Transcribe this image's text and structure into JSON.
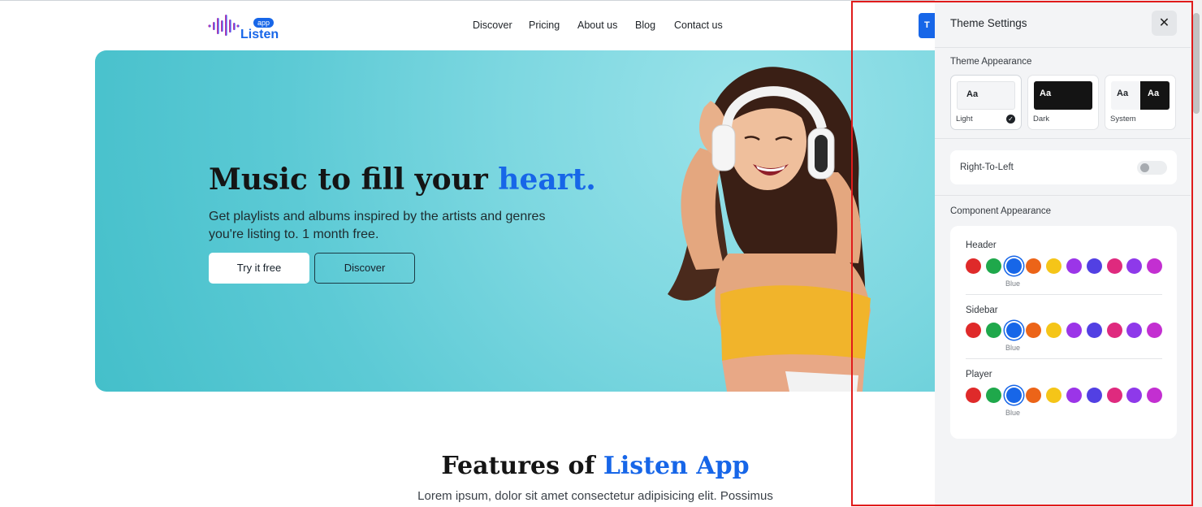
{
  "logo": {
    "badge": "app",
    "word": "Listen"
  },
  "nav": {
    "items": [
      "Discover",
      "Pricing",
      "About us",
      "Blog",
      "Contact us"
    ]
  },
  "cta_peek": "T",
  "hero": {
    "title_main": "Music to fill your ",
    "title_accent": "heart.",
    "subtitle": "Get playlists and albums inspired by the artists and genres you're listing to. 1 month free.",
    "try_button": "Try it free",
    "discover_button": "Discover"
  },
  "features": {
    "title_main": "Features of ",
    "title_accent": "Listen App",
    "subtitle": "Lorem ipsum, dolor sit amet consectetur adipisicing elit. Possimus"
  },
  "settings": {
    "title": "Theme Settings",
    "close_glyph": "✕",
    "appearance_label": "Theme Appearance",
    "themes": [
      {
        "preview": "Aa",
        "label": "Light",
        "selected": true
      },
      {
        "preview": "Aa",
        "label": "Dark",
        "selected": false
      },
      {
        "preview_light": "Aa",
        "preview_dark": "Aa",
        "label": "System",
        "selected": false
      }
    ],
    "rtl_label": "Right-To-Left",
    "rtl_enabled": false,
    "component_label": "Component Appearance",
    "groups": [
      {
        "label": "Header",
        "selected_caption": "Blue"
      },
      {
        "label": "Sidebar",
        "selected_caption": "Blue"
      },
      {
        "label": "Player",
        "selected_caption": "Blue"
      }
    ],
    "palette": [
      "#df2a2a",
      "#1fa84b",
      "#1766e8",
      "#ec6418",
      "#f5c518",
      "#9b35e8",
      "#5240e3",
      "#df2a7e",
      "#8e39ea",
      "#c32fd1"
    ],
    "selected_index": 2
  },
  "colors": {
    "accent": "#1766e8",
    "highlight_border": "#e01b1b",
    "hero_teal": "#5ccad5"
  }
}
